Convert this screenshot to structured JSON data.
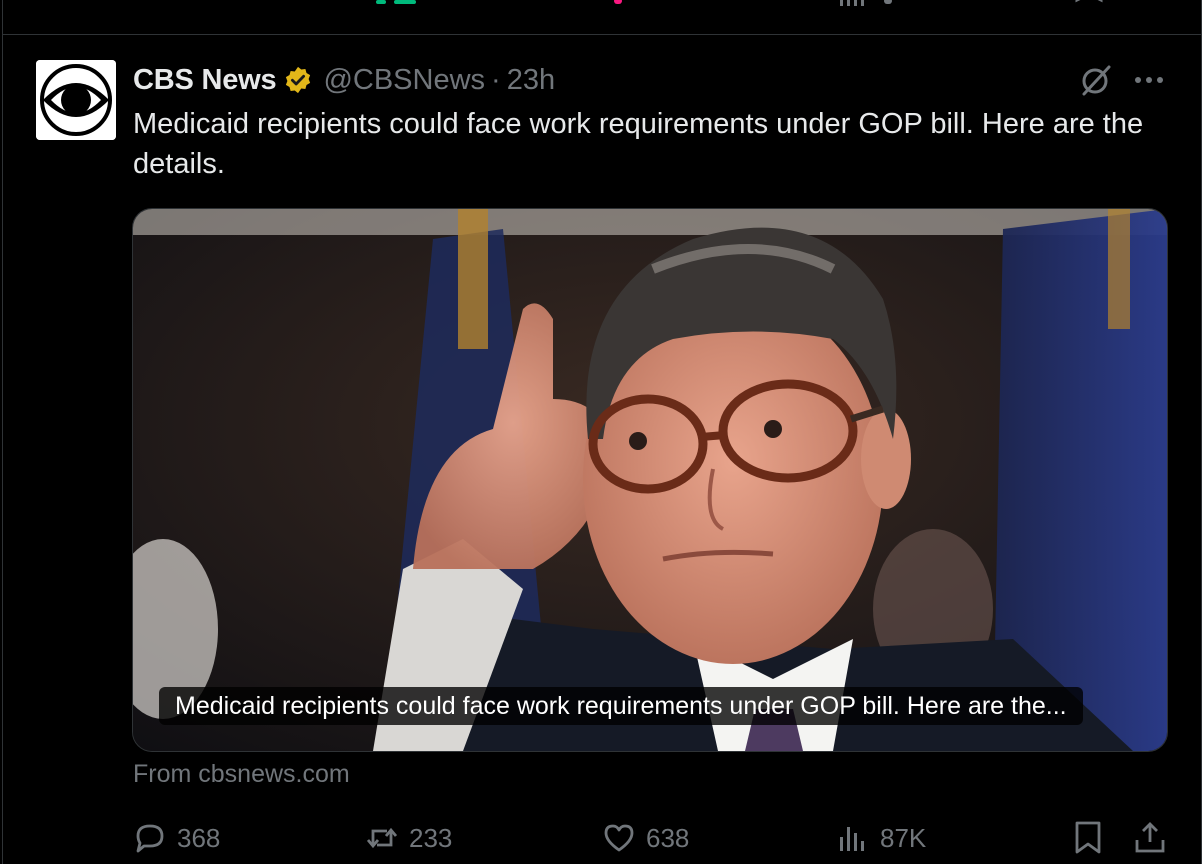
{
  "tweet": {
    "author_name": "CBS News",
    "handle": "@CBSNews",
    "separator": "·",
    "time": "23h",
    "text": "Medicaid recipients could face work requirements under GOP bill. Here are the details.",
    "card": {
      "caption": "Medicaid recipients could face work requirements under GOP bill. Here are the...",
      "source": "From cbsnews.com"
    },
    "stats": {
      "replies": "368",
      "reposts": "233",
      "likes": "638",
      "views": "87K"
    }
  },
  "icons": {
    "verified": "verified-badge-icon",
    "grok": "grok-icon",
    "more": "more-icon",
    "reply": "reply-icon",
    "repost": "repost-icon",
    "like": "like-icon",
    "views": "views-icon",
    "bookmark": "bookmark-icon",
    "share": "share-icon"
  },
  "colors": {
    "background": "#000000",
    "text": "#e7e9ea",
    "muted": "#71767b",
    "border": "#2f3336",
    "verified_gold": "#e2b719"
  }
}
